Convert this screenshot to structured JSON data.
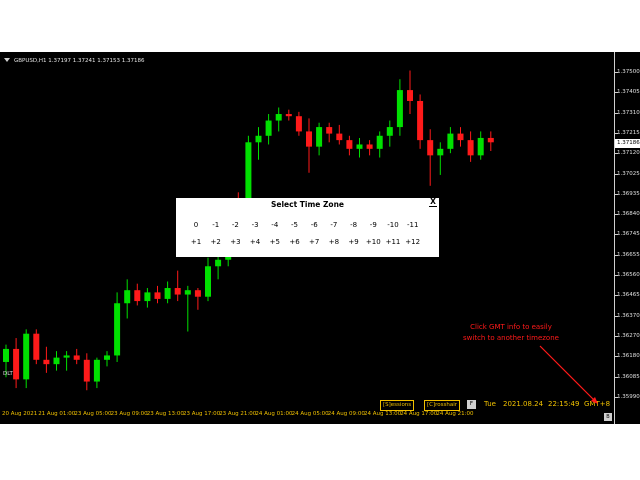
{
  "window": {
    "symbol_title": "GBPUSD,H1  1.37197 1.37241 1.37153 1.37186",
    "indicator_label": "DLT"
  },
  "price_axis": {
    "labels": [
      "1.37500",
      "1.37405",
      "1.37310",
      "1.37215",
      "1.37120",
      "1.37025",
      "1.36935",
      "1.36840",
      "1.36745",
      "1.36655",
      "1.36560",
      "1.36465",
      "1.36370",
      "1.36270",
      "1.36180",
      "1.36085",
      "1.35990"
    ],
    "current_price": "1.37186"
  },
  "time_axis": {
    "labels": [
      "20 Aug 2021",
      "21 Aug 01:00",
      "23 Aug 05:00",
      "23 Aug 09:00",
      "23 Aug 13:00",
      "23 Aug 17:00",
      "23 Aug 21:00",
      "24 Aug 01:00",
      "24 Aug 05:00",
      "24 Aug 09:00",
      "24 Aug 13:00",
      "24 Aug 17:00",
      "24 Aug 21:00"
    ]
  },
  "toolbar": {
    "sessions_hotkey": "[S]",
    "sessions_rest": "essions",
    "crosshair_hotkey": "[C]",
    "crosshair_rest": "rosshair",
    "f_label": "F",
    "day": "Tue",
    "date": "2021.08.24",
    "time": "22:15:49",
    "gmt": "GMT+8"
  },
  "annotation": {
    "line1": "Click GMT info to easily",
    "line2": "switch to another timezone"
  },
  "corner_label": "B",
  "dialog": {
    "title": "Select Time Zone",
    "close_label": "X",
    "negative": [
      "0",
      "-1",
      "-2",
      "-3",
      "-4",
      "-5",
      "-6",
      "-7",
      "-8",
      "-9",
      "-10",
      "-11"
    ],
    "positive": [
      "+1",
      "+2",
      "+3",
      "+4",
      "+5",
      "+6",
      "+7",
      "+8",
      "+9",
      "+10",
      "+11",
      "+12"
    ]
  },
  "colors": {
    "bull": "#00e000",
    "bear": "#ff1a1a",
    "background": "#000000",
    "axis_text": "#f2c200",
    "annotation": "#ff1a1a"
  },
  "chart_data": {
    "type": "candlestick",
    "ylim": [
      1.3595,
      1.3755
    ],
    "candles": [
      {
        "o": 1.3618,
        "h": 1.3626,
        "l": 1.3611,
        "c": 1.3624
      },
      {
        "o": 1.3624,
        "h": 1.3629,
        "l": 1.3606,
        "c": 1.361
      },
      {
        "o": 1.361,
        "h": 1.3633,
        "l": 1.3606,
        "c": 1.3631
      },
      {
        "o": 1.3631,
        "h": 1.3633,
        "l": 1.3617,
        "c": 1.3619
      },
      {
        "o": 1.3619,
        "h": 1.3625,
        "l": 1.3613,
        "c": 1.3617
      },
      {
        "o": 1.3617,
        "h": 1.3623,
        "l": 1.3614,
        "c": 1.362
      },
      {
        "o": 1.362,
        "h": 1.3623,
        "l": 1.3614,
        "c": 1.3621
      },
      {
        "o": 1.3621,
        "h": 1.3624,
        "l": 1.3617,
        "c": 1.3619
      },
      {
        "o": 1.3619,
        "h": 1.3622,
        "l": 1.3605,
        "c": 1.3609
      },
      {
        "o": 1.3609,
        "h": 1.362,
        "l": 1.3606,
        "c": 1.3619
      },
      {
        "o": 1.3619,
        "h": 1.3623,
        "l": 1.3616,
        "c": 1.3621
      },
      {
        "o": 1.3621,
        "h": 1.365,
        "l": 1.3618,
        "c": 1.3645
      },
      {
        "o": 1.3645,
        "h": 1.3656,
        "l": 1.3638,
        "c": 1.3651
      },
      {
        "o": 1.3651,
        "h": 1.3654,
        "l": 1.3644,
        "c": 1.3646
      },
      {
        "o": 1.3646,
        "h": 1.3652,
        "l": 1.3643,
        "c": 1.365
      },
      {
        "o": 1.365,
        "h": 1.3653,
        "l": 1.3645,
        "c": 1.3647
      },
      {
        "o": 1.3647,
        "h": 1.3655,
        "l": 1.3645,
        "c": 1.3652
      },
      {
        "o": 1.3652,
        "h": 1.366,
        "l": 1.3646,
        "c": 1.3649
      },
      {
        "o": 1.3649,
        "h": 1.3653,
        "l": 1.3632,
        "c": 1.3651
      },
      {
        "o": 1.3651,
        "h": 1.3652,
        "l": 1.3642,
        "c": 1.3648
      },
      {
        "o": 1.3648,
        "h": 1.3666,
        "l": 1.3646,
        "c": 1.3662
      },
      {
        "o": 1.3662,
        "h": 1.3676,
        "l": 1.3656,
        "c": 1.3665
      },
      {
        "o": 1.3665,
        "h": 1.3692,
        "l": 1.3662,
        "c": 1.369
      },
      {
        "o": 1.369,
        "h": 1.3696,
        "l": 1.3682,
        "c": 1.3688
      },
      {
        "o": 1.3688,
        "h": 1.3722,
        "l": 1.3683,
        "c": 1.3719
      },
      {
        "o": 1.3719,
        "h": 1.3726,
        "l": 1.3711,
        "c": 1.3722
      },
      {
        "o": 1.3722,
        "h": 1.3732,
        "l": 1.3718,
        "c": 1.3729
      },
      {
        "o": 1.3729,
        "h": 1.3735,
        "l": 1.3724,
        "c": 1.3732
      },
      {
        "o": 1.3732,
        "h": 1.3734,
        "l": 1.3729,
        "c": 1.3731
      },
      {
        "o": 1.3731,
        "h": 1.3733,
        "l": 1.3722,
        "c": 1.3724
      },
      {
        "o": 1.3724,
        "h": 1.373,
        "l": 1.3705,
        "c": 1.3717
      },
      {
        "o": 1.3717,
        "h": 1.3728,
        "l": 1.3713,
        "c": 1.3726
      },
      {
        "o": 1.3726,
        "h": 1.3728,
        "l": 1.3719,
        "c": 1.3723
      },
      {
        "o": 1.3723,
        "h": 1.3727,
        "l": 1.3718,
        "c": 1.372
      },
      {
        "o": 1.372,
        "h": 1.3722,
        "l": 1.3713,
        "c": 1.3716
      },
      {
        "o": 1.3716,
        "h": 1.3721,
        "l": 1.3712,
        "c": 1.3718
      },
      {
        "o": 1.3718,
        "h": 1.372,
        "l": 1.3713,
        "c": 1.3716
      },
      {
        "o": 1.3716,
        "h": 1.3724,
        "l": 1.3712,
        "c": 1.3722
      },
      {
        "o": 1.3722,
        "h": 1.3729,
        "l": 1.3717,
        "c": 1.3726
      },
      {
        "o": 1.3726,
        "h": 1.3748,
        "l": 1.3722,
        "c": 1.3743
      },
      {
        "o": 1.3743,
        "h": 1.3752,
        "l": 1.3732,
        "c": 1.3738
      },
      {
        "o": 1.3738,
        "h": 1.3741,
        "l": 1.3716,
        "c": 1.372
      },
      {
        "o": 1.372,
        "h": 1.3725,
        "l": 1.3699,
        "c": 1.3713
      },
      {
        "o": 1.3713,
        "h": 1.3719,
        "l": 1.3704,
        "c": 1.3716
      },
      {
        "o": 1.3716,
        "h": 1.3726,
        "l": 1.3714,
        "c": 1.3723
      },
      {
        "o": 1.3723,
        "h": 1.3726,
        "l": 1.3717,
        "c": 1.372
      },
      {
        "o": 1.372,
        "h": 1.3724,
        "l": 1.371,
        "c": 1.3713
      },
      {
        "o": 1.3713,
        "h": 1.3724,
        "l": 1.3711,
        "c": 1.3721
      },
      {
        "o": 1.3721,
        "h": 1.3724,
        "l": 1.3715,
        "c": 1.3719
      }
    ]
  }
}
